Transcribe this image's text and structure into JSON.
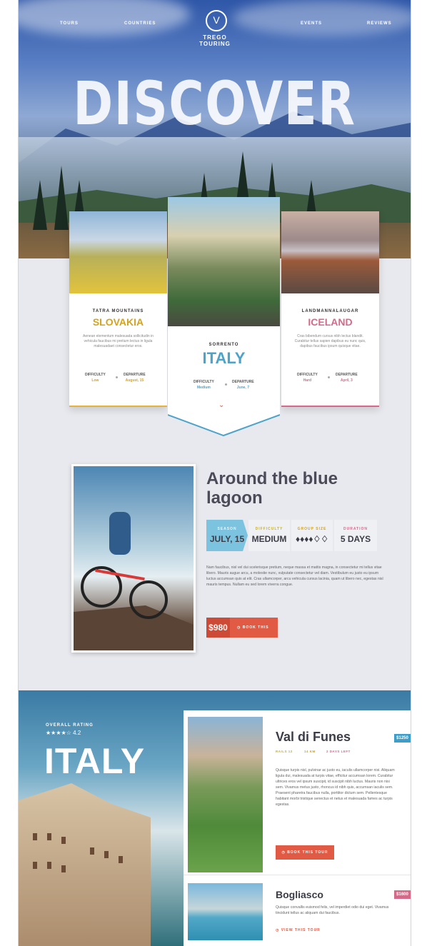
{
  "nav": {
    "tours": "TOURS",
    "countries": "COUNTRIES",
    "events": "EVENTS",
    "reviews": "REVIEWS"
  },
  "brand": {
    "name": "TREGO TOURING",
    "logo": "V"
  },
  "hero": {
    "headline": "DISCOVER"
  },
  "cards": [
    {
      "subtitle": "TATRA MOUNTAINS",
      "title": "SLOVAKIA",
      "title_color": "#d4a21e",
      "desc": "Aenean elementum malesuada sollicitudin in vehicula faucibus mi pretium lectus in ligula malesuadaet consectetur eros.",
      "difficulty_label": "DIFFICULTY",
      "difficulty": "Low",
      "departure_label": "DEPARTURE",
      "departure": "August, 15",
      "accent": "#e7b23a"
    },
    {
      "subtitle": "SORRENTO",
      "title": "ITALY",
      "title_color": "#4ea3c8",
      "difficulty_label": "DIFFICULTY",
      "difficulty": "Medium",
      "departure_label": "DEPARTURE",
      "departure": "June, 7",
      "accent": "#e05a44"
    },
    {
      "subtitle": "LANDMANNALAUGAR",
      "title": "ICELAND",
      "title_color": "#d46a8a",
      "desc": "Cras bibendum cursus nibh lectus blandit. Curabitur tellus sapien dapibus eu nunc quis, dapibus faucibus ipsum quisque vitae.",
      "difficulty_label": "DIFFICULTY",
      "difficulty": "Hard",
      "departure_label": "DEPARTURE",
      "departure": "April, 3",
      "accent": "#d46a8a"
    }
  ],
  "lagoon": {
    "title_line1": "Around the blue",
    "title_line2": "lagoon",
    "stats": [
      {
        "label": "SEASON",
        "value": "JULY, 15",
        "label_color": "#eaf6fb",
        "bg": "#7bc3df"
      },
      {
        "label": "DIFFICULTY",
        "value": "MEDIUM",
        "label_color": "#c1b13a",
        "bg": "#eef0f3"
      },
      {
        "label": "GROUP SIZE",
        "value": "♦♦♦♦♢♢",
        "label_color": "#d4a21e",
        "bg": "#eef0f3"
      },
      {
        "label": "DURATION",
        "value": "5 DAYS",
        "label_color": "#d46a8a",
        "bg": "#eef0f3"
      }
    ],
    "body": "Nam faucibus, nisl vel dui scelerisque pretium, neque massa et mattis magna, in consectetur mi tellus vitae libero. Mauris augue arcu, a molestie nunc, vulputate consectetur vel diam. Vestibulum eu justo eu ipsum luctus accumsan quis at elit. Cras ullamcorper, arcu vehicula cursus lacinia, quam ut libero nec, egestas nisl mauris tempus. Nullam eu sed lorem viverra congue.",
    "price": "$980",
    "book_label": "BOOK THIS"
  },
  "italy": {
    "rating_label": "OVERALL RATING",
    "rating_stars": "★★★★☆",
    "rating_value": "4.2",
    "title": "ITALY"
  },
  "tours": [
    {
      "name": "Val di Funes",
      "price": "$1250",
      "tags": [
        "RAILS 12",
        "14 KM",
        "2 DAYS LEFT"
      ],
      "tag_colors": [
        "#c1b13a",
        "#d4a21e",
        "#d46a8a"
      ],
      "desc": "Quisque turpis nisl, pulvinar ac justo eu, iaculis ullamcorper nisi. Aliquam ligula dui, malesuada at turpis vitae, efficitur accumsan lorem. Curabitur ultrices eros vel ipsum suscipit, id suscipit nibh luctus. Mauris non nisi sem. Vivamus metus justo, rhoncus id nibh quis, accumsan iaculis sem. Praesent pharetra faucibus nulla, porttitor dictum sem. Pellentesque habitant morbi tristique senectus et netus et malesuada fames ac turpis egestas.",
      "button": "BOOK THIS TOUR",
      "badge_color": "#3d9fc9"
    },
    {
      "name": "Bogliasco",
      "price": "$1600",
      "desc": "Quisque convallis euismod felis, vel imperdiet odio dui eget. Vivamus tincidunt tellus ac aliquam dui faucibus.",
      "button": "VIEW THIS TOUR",
      "badge_color": "#d46a8a"
    }
  ],
  "colors": {
    "accent": "#e05a44",
    "blue": "#4ea3c8"
  }
}
